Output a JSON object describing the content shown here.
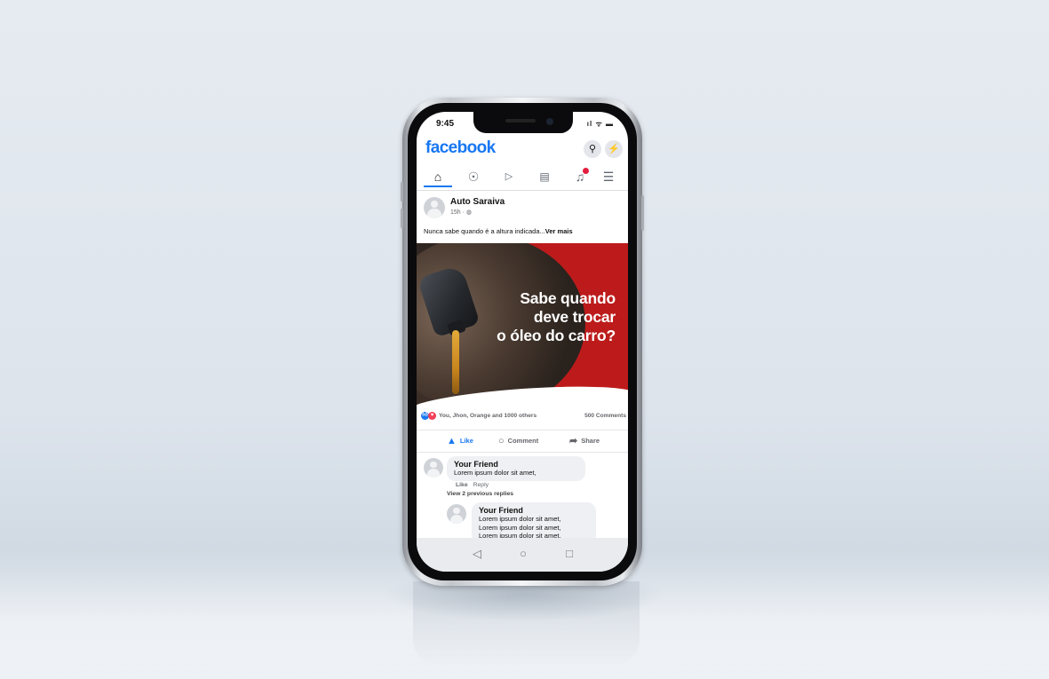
{
  "status_bar": {
    "time": "9:45",
    "indicators": "ıl ᯤ ▬"
  },
  "header": {
    "logo": "facebook",
    "icons": [
      "search-icon",
      "messenger-icon"
    ]
  },
  "nav": {
    "items": [
      "home-icon",
      "groups-icon",
      "watch-icon",
      "marketplace-icon",
      "notifications-icon",
      "menu-icon"
    ],
    "active": "home-icon"
  },
  "post": {
    "page_name": "Auto Saraiva",
    "meta": "15h · ◍",
    "text": "Nunca sabe quando é a altura indicada...",
    "see_more": "Ver mais",
    "image_headline": [
      "Sabe quando",
      "deve trocar",
      "o óleo do carro?"
    ],
    "reactions_text": "You, Jhon, Orange and 1000 others",
    "comments_count": "500 Comments",
    "actions": {
      "like": "Like",
      "comment": "Comment",
      "share": "Share"
    }
  },
  "comments": [
    {
      "author": "Your Friend",
      "lines": [
        "Lorem ipsum dolor sit amet,"
      ],
      "like": "Like",
      "reply": "Reply"
    }
  ],
  "view_previous": "View 2 previous replies",
  "replies": [
    {
      "author": "Your Friend",
      "lines": [
        "Lorem ipsum dolor sit amet,",
        "Lorem ipsum dolor sit amet,",
        "Lorem ipsum dolor sit amet,"
      ]
    }
  ],
  "android_nav": {
    "back": "◁",
    "home": "○",
    "recents": "□"
  },
  "colors": {
    "brand": "#1877f2",
    "image_red": "#bd1b1b",
    "background": "#e6ebf1"
  }
}
